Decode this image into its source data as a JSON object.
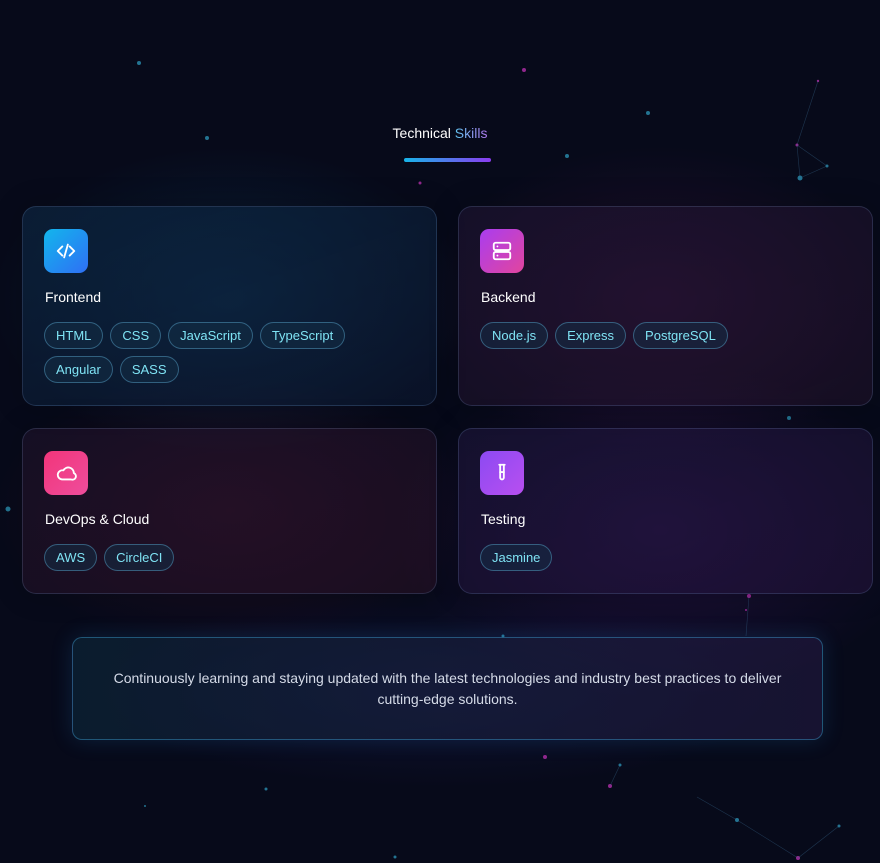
{
  "section": {
    "title_plain": "Technical",
    "title_accent": "Skills"
  },
  "cards": [
    {
      "title": "Frontend",
      "icon": "code-icon",
      "tags": [
        "HTML",
        "CSS",
        "JavaScript",
        "TypeScript",
        "Angular",
        "SASS"
      ]
    },
    {
      "title": "Backend",
      "icon": "server-icon",
      "tags": [
        "Node.js",
        "Express",
        "PostgreSQL"
      ]
    },
    {
      "title": "DevOps & Cloud",
      "icon": "cloud-icon",
      "tags": [
        "AWS",
        "CircleCI"
      ]
    },
    {
      "title": "Testing",
      "icon": "test-tube-icon",
      "tags": [
        "Jasmine"
      ]
    }
  ],
  "note": {
    "text": "Continuously learning and staying updated with the latest technologies and industry best practices to deliver cutting-edge solutions."
  },
  "colors": {
    "background": "#070a1a",
    "tag_text": "#7fe3f4",
    "accent_start": "#18b4e8",
    "accent_end": "#8b3cf0"
  }
}
